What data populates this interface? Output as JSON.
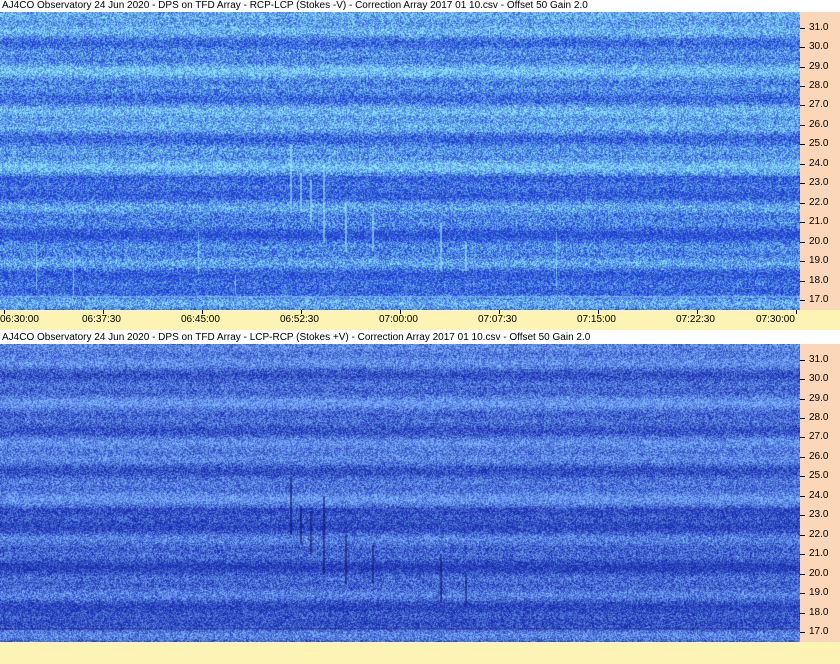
{
  "panels": [
    {
      "title": "AJ4CO Observatory 24 Jun 2020  -  DPS on TFD Array  -  RCP-LCP (Stokes -V)  -  Correction Array 2017 01 10.csv  -  Offset 50  Gain 2.0"
    },
    {
      "title": "AJ4CO Observatory 24 Jun 2020  -  DPS on TFD Array  -  LCP-RCP (Stokes +V)  -  Correction Array 2017 01 10.csv  -  Offset 50  Gain 2.0"
    }
  ],
  "chart_data": [
    {
      "type": "heatmap",
      "title": "AJ4CO Observatory 24 Jun 2020  -  DPS on TFD Array  -  RCP-LCP (Stokes -V)  -  Correction Array 2017 01 10.csv  -  Offset 50  Gain 2.0",
      "x_range": [
        "06:30:00",
        "07:30:00"
      ],
      "x_ticks": [
        "06:30:00",
        "06:37:30",
        "06:45:00",
        "06:52:30",
        "07:00:00",
        "07:07:30",
        "07:15:00",
        "07:22:30",
        "07:30:00"
      ],
      "y_range": [
        16.5,
        31.8
      ],
      "y_ticks": [
        "17.0",
        "18.0",
        "19.0",
        "20.0",
        "21.0",
        "22.0",
        "23.0",
        "24.0",
        "25.0",
        "26.0",
        "27.0",
        "28.0",
        "29.0",
        "30.0",
        "31.0"
      ],
      "colors": {
        "low": "#1e3fcf",
        "high": "#8fe6ff"
      }
    },
    {
      "type": "heatmap",
      "title": "AJ4CO Observatory 24 Jun 2020  -  DPS on TFD Array  -  LCP-RCP (Stokes +V)  -  Correction Array 2017 01 10.csv  -  Offset 50  Gain 2.0",
      "x_range": [
        "06:30:00",
        "07:30:00"
      ],
      "y_range": [
        16.5,
        31.8
      ],
      "y_ticks": [
        "17.0",
        "18.0",
        "19.0",
        "20.0",
        "21.0",
        "22.0",
        "23.0",
        "24.0",
        "25.0",
        "26.0",
        "27.0",
        "28.0",
        "29.0",
        "30.0",
        "31.0"
      ],
      "colors": {
        "low": "#1a2fb0",
        "high": "#7fb6ff"
      }
    }
  ]
}
